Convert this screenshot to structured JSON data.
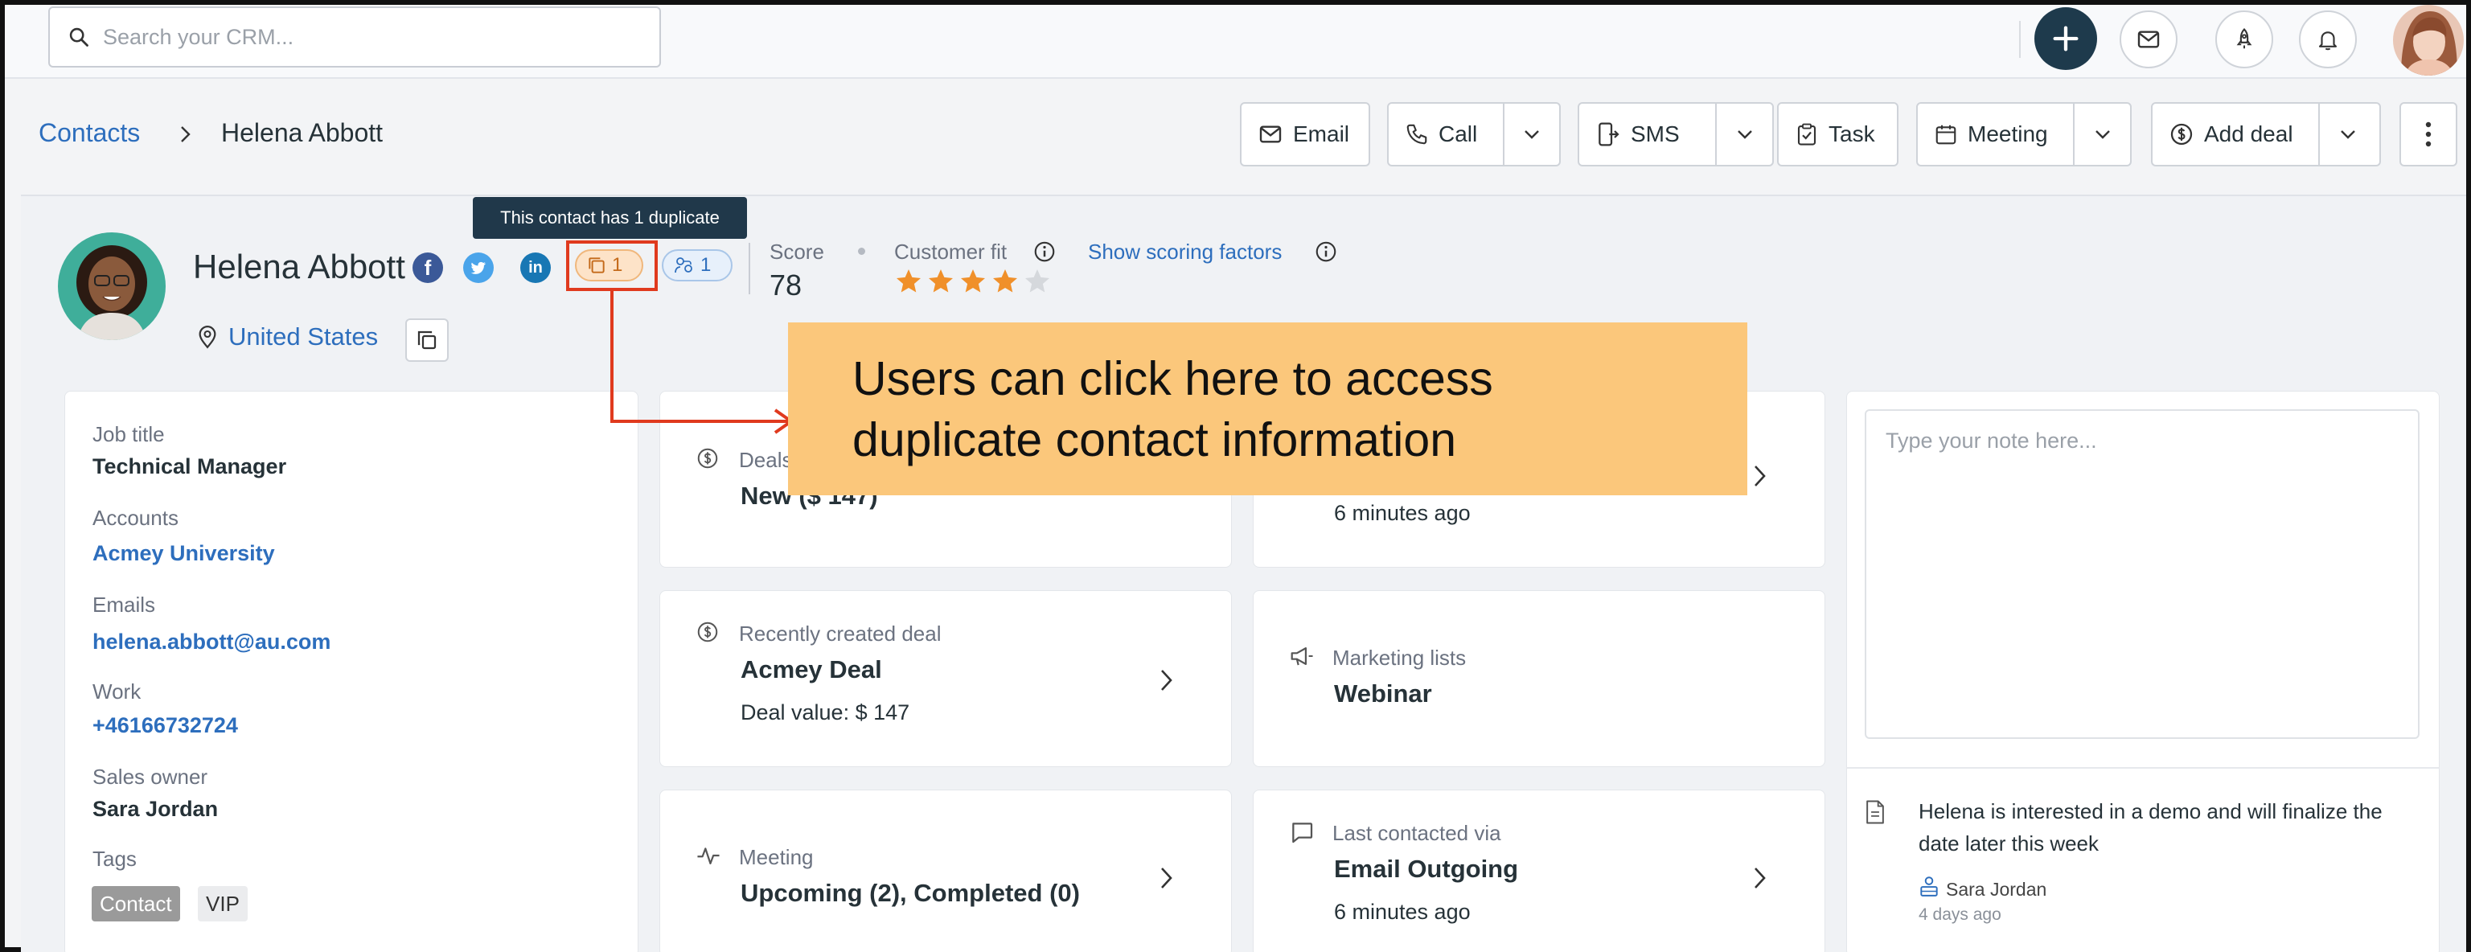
{
  "topbar": {
    "search_placeholder": "Search your CRM..."
  },
  "breadcrumb": {
    "parent": "Contacts",
    "current": "Helena Abbott"
  },
  "actions": {
    "email": "Email",
    "call": "Call",
    "sms": "SMS",
    "task": "Task",
    "meeting": "Meeting",
    "add_deal": "Add deal"
  },
  "contact": {
    "name": "Helena Abbott",
    "location": "United States",
    "duplicates_count": "1",
    "related_count": "1",
    "duplicate_tooltip": "This contact has 1 duplicate",
    "score_label": "Score",
    "score_value": "78",
    "customer_fit_label": "Customer fit",
    "customer_fit_stars": 4,
    "customer_fit_max": 5,
    "scoring_link": "Show scoring factors"
  },
  "details": {
    "job_title_label": "Job title",
    "job_title": "Technical Manager",
    "accounts_label": "Accounts",
    "account": "Acmey University",
    "emails_label": "Emails",
    "email": "helena.abbott@au.com",
    "work_label": "Work",
    "work_phone": "+46166732724",
    "sales_owner_label": "Sales owner",
    "sales_owner": "Sara Jordan",
    "tags_label": "Tags",
    "tags": [
      "Contact",
      "VIP"
    ]
  },
  "cards": {
    "deals_label": "Deals",
    "deals_value": "New ($ 147)",
    "activity_time": "6 minutes ago",
    "recent_deal_label": "Recently created deal",
    "recent_deal_name": "Acmey Deal",
    "recent_deal_value": "Deal value: $ 147",
    "marketing_label": "Marketing lists",
    "marketing_value": "Webinar",
    "meeting_label": "Meeting",
    "meeting_value": "Upcoming (2), Completed (0)",
    "last_contacted_label": "Last contacted via",
    "last_contacted_value": "Email Outgoing",
    "last_contacted_time": "6 minutes ago"
  },
  "notes": {
    "placeholder": "Type your note here...",
    "note_text": "Helena is interested in a demo and will finalize the date later this week",
    "note_author": "Sara Jordan",
    "note_time": "4 days ago"
  },
  "annotation": {
    "callout_text": "Users can click here to access\nduplicate contact information"
  },
  "colors": {
    "link": "#2d6ebd",
    "callout_bg": "#fbc77b",
    "highlight": "#e03a1e",
    "star": "#f0902a"
  }
}
